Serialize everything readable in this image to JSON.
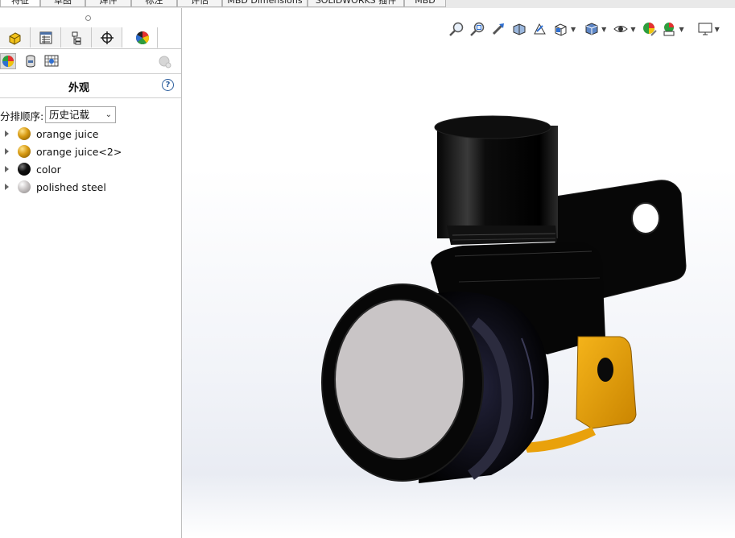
{
  "command_tabs": [
    "特征",
    "草图",
    "焊件",
    "标注",
    "评估",
    "MBD Dimensions",
    "SOLIDWORKS 插件",
    "MBD"
  ],
  "manager_tabs": [
    {
      "name": "featuremanager-tab",
      "icon": "part-icon"
    },
    {
      "name": "propertymanager-tab",
      "icon": "property-list-icon"
    },
    {
      "name": "configurationmanager-tab",
      "icon": "configuration-icon"
    },
    {
      "name": "dimxpert-tab",
      "icon": "crosshair-icon"
    },
    {
      "name": "displaymanager-tab",
      "icon": "appearance-ball-icon"
    }
  ],
  "display_tools": [
    "appearances-view-icon",
    "decals-view-icon",
    "scenes-view-icon"
  ],
  "panel": {
    "title": "外观",
    "sort_label": "分排顺序:",
    "sort_value": "历史记载",
    "appearances": [
      {
        "label": "orange juice",
        "color": "#d79a12"
      },
      {
        "label": "orange juice<2>",
        "color": "#d79a12"
      },
      {
        "label": "color",
        "color": "#0a0a0a"
      },
      {
        "label": "polished steel",
        "color": "#c8c4c4"
      }
    ]
  },
  "heads_up_toolbar": [
    "zoom-to-fit-icon",
    "zoom-to-area-icon",
    "previous-view-icon",
    "section-view-icon",
    "dynamic-annotation-icon",
    "view-orientation-icon",
    "display-style-icon",
    "hide-show-items-icon",
    "edit-appearance-icon",
    "apply-scene-icon",
    "view-settings-icon"
  ],
  "colors": {
    "accent_orange": "#e9a10b",
    "part_black": "#0a0a0a",
    "lens_gray": "#c9c5c6"
  }
}
